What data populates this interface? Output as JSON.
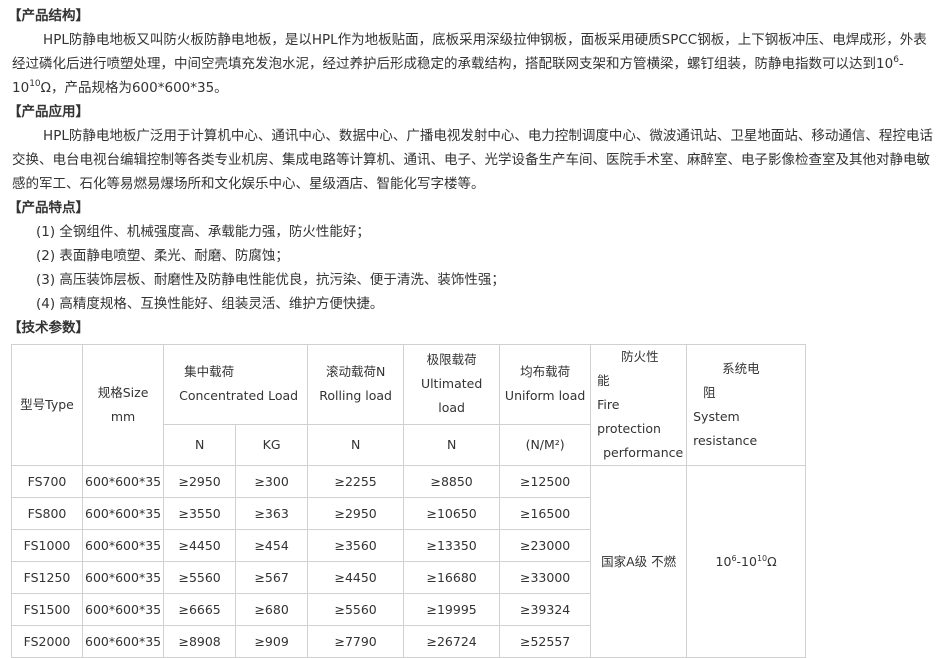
{
  "structure": {
    "title": "【产品结构】",
    "text_part1": "HPL防静电地板又叫防火板防静电地板，是以HPL作为地板贴面，底板采用深级拉伸钢板，面板采用硬质SPCC钢板，上下钢板冲压、电焊成形，外表经过磷化后进行喷塑处理，中间空壳填充发泡水泥，经过养护后形成稳定的承载结构，搭配联网支架和方管横梁，螺钉组装，防静电指数可以达到10",
    "exp1": "6",
    "text_part2": "-10",
    "exp2": "10",
    "text_part3": "Ω，产品规格为600*600*35。"
  },
  "application": {
    "title": "【产品应用】",
    "text": "HPL防静电地板广泛用于计算机中心、通讯中心、数据中心、广播电视发射中心、电力控制调度中心、微波通讯站、卫星地面站、移动通信、程控电话交换、电台电视台编辑控制等各类专业机房、集成电路等计算机、通讯、电子、光学设备生产车间、医院手术室、麻醉室、电子影像检查室及其他对静电敏感的军工、石化等易燃易爆场所和文化娱乐中心、星级酒店、智能化写字楼等。"
  },
  "features": {
    "title": "【产品特点】",
    "items": [
      "(1) 全钢组件、机械强度高、承载能力强，防火性能好；",
      "(2) 表面静电喷塑、柔光、耐磨、防腐蚀；",
      "(3) 高压装饰层板、耐磨性及防静电性能优良，抗污染、便于清洗、装饰性强；",
      "(4) 高精度规格、互换性能好、组装灵活、维护方便快捷。"
    ]
  },
  "specs": {
    "title": "【技术参数】",
    "headers": {
      "model": "型号Type",
      "size": "规格Size",
      "size_unit": "mm",
      "concentrated_cn": "集中载荷",
      "concentrated_en": "Concentrated Load",
      "rolling_cn": "滚动载荷N",
      "rolling_en": "Rolling load",
      "ultimate_cn": "极限载荷",
      "ultimate_en": "Ultimated load",
      "uniform_cn": "均布载荷",
      "uniform_en": "Uniform load",
      "fire_cn_1": "防火性",
      "fire_cn_2": "能",
      "fire_en_1": "Fire protection",
      "fire_en_2": "performance",
      "resist_cn_1": "系统电",
      "resist_cn_2": "阻",
      "resist_en": "System resistance",
      "unit_n1": "N",
      "unit_kg": "KG",
      "unit_n2": "N",
      "unit_n3": "N",
      "unit_nm2": "(N/M²)"
    },
    "rows": [
      {
        "model": "FS700",
        "size": "600*600*35",
        "conc_n": "≥2950",
        "conc_kg": "≥300",
        "rolling": "≥2255",
        "ultimate": "≥8850",
        "uniform": "≥12500"
      },
      {
        "model": "FS800",
        "size": "600*600*35",
        "conc_n": "≥3550",
        "conc_kg": "≥363",
        "rolling": "≥2950",
        "ultimate": "≥10650",
        "uniform": "≥16500"
      },
      {
        "model": "FS1000",
        "size": "600*600*35",
        "conc_n": "≥4450",
        "conc_kg": "≥454",
        "rolling": "≥3560",
        "ultimate": "≥13350",
        "uniform": "≥23000"
      },
      {
        "model": "FS1250",
        "size": "600*600*35",
        "conc_n": "≥5560",
        "conc_kg": "≥567",
        "rolling": "≥4450",
        "ultimate": "≥16680",
        "uniform": "≥33000"
      },
      {
        "model": "FS1500",
        "size": "600*600*35",
        "conc_n": "≥6665",
        "conc_kg": "≥680",
        "rolling": "≥5560",
        "ultimate": "≥19995",
        "uniform": "≥39324"
      },
      {
        "model": "FS2000",
        "size": "600*600*35",
        "conc_n": "≥8908",
        "conc_kg": "≥909",
        "rolling": "≥7790",
        "ultimate": "≥26724",
        "uniform": "≥52557"
      }
    ],
    "fire_value": "国家A级  不燃",
    "resist_base1": "10",
    "resist_exp1": "6",
    "resist_mid": "-10",
    "resist_exp2": "10",
    "resist_tail": "Ω"
  }
}
